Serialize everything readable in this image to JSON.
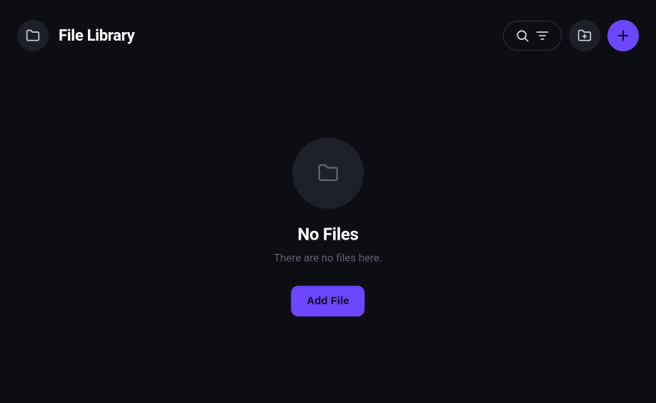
{
  "header": {
    "title": "File Library"
  },
  "empty_state": {
    "title": "No Files",
    "subtitle": "There are no files here.",
    "button_label": "Add File"
  },
  "colors": {
    "accent": "#6c47ff",
    "background": "#0d0e14",
    "surface": "#1e2029",
    "muted": "#5e6170"
  }
}
